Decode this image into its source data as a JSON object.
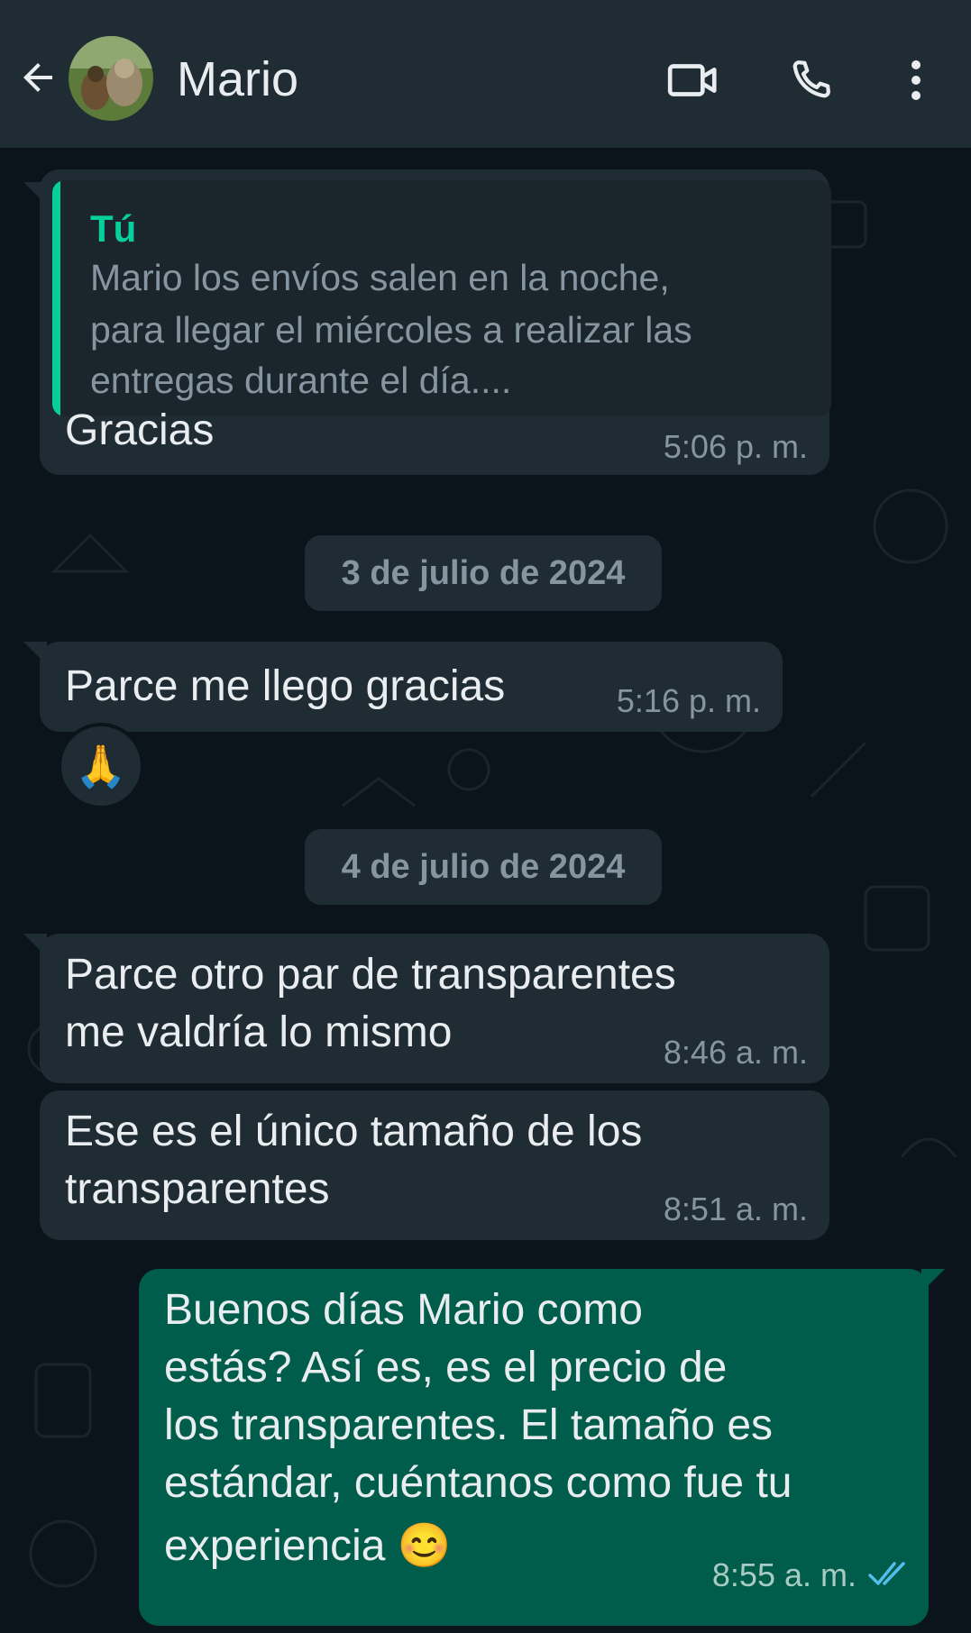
{
  "header": {
    "contact_name": "Mario",
    "icons": [
      "back-arrow-icon",
      "video-call-icon",
      "voice-call-icon",
      "more-options-icon"
    ]
  },
  "messages": [
    {
      "quote": {
        "author": "Tú",
        "lines": [
          "Mario los envíos salen en la noche,",
          "para llegar el miércoles a realizar las",
          "entregas durante el día...."
        ]
      },
      "text": "Gracias",
      "time": "5:06 p. m."
    },
    {
      "date": "3 de julio de 2024"
    },
    {
      "text": "Parce me llego gracias",
      "time": "5:16 p. m.",
      "reaction": "🙏"
    },
    {
      "date": "4 de julio de 2024"
    },
    {
      "lines": [
        "Parce otro par de transparentes",
        "me valdría lo mismo"
      ],
      "time": "8:46 a. m."
    },
    {
      "lines": [
        "Ese es el único tamaño de los",
        "transparentes"
      ],
      "time": "8:51 a. m."
    },
    {
      "lines": [
        "Buenos días Mario como",
        "estás? Así es, es el precio de",
        "los transparentes. El tamaño es",
        "estándar, cuéntanos como fue tu",
        "experiencia 😊"
      ],
      "time": "8:55 a. m.",
      "status": "read-double-check"
    }
  ],
  "colors": {
    "header_bg": "#1f2c34",
    "chat_bg": "#0b141a",
    "incoming_bubble": "#1f2c34",
    "outgoing_bubble": "#005c4b",
    "accent": "#06cf9c",
    "read_check": "#53bdeb"
  }
}
